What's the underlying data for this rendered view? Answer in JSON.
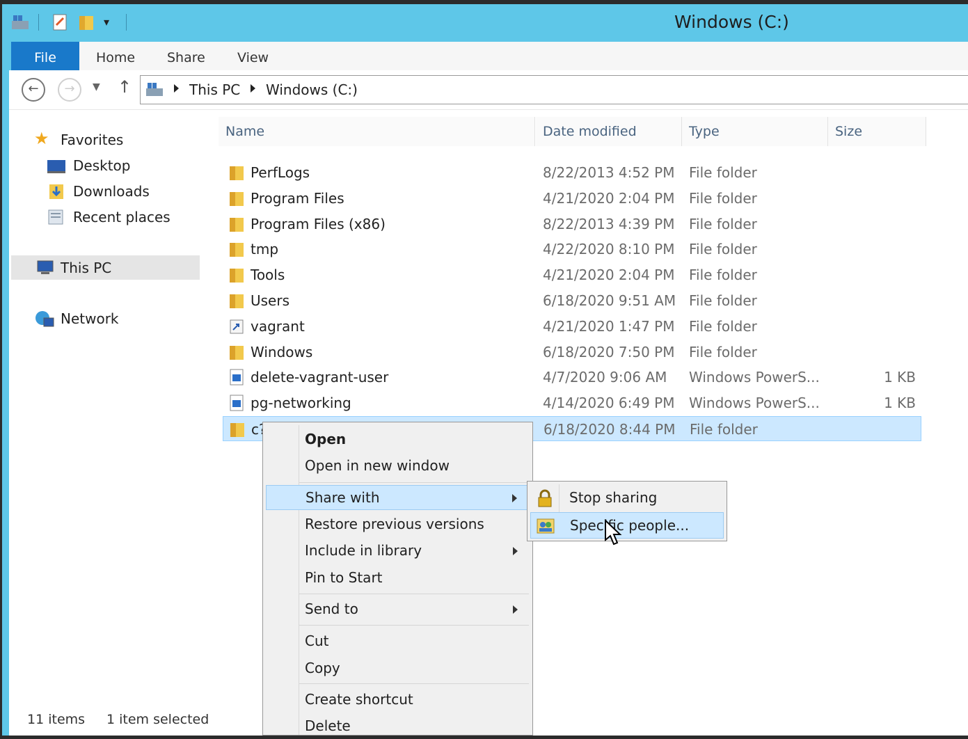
{
  "window": {
    "title": "Windows (C:)"
  },
  "ribbon": {
    "tabs": [
      "File",
      "Home",
      "Share",
      "View"
    ]
  },
  "address": {
    "crumbs": [
      "This PC",
      "Windows (C:)"
    ]
  },
  "sidebar": {
    "favorites": "Favorites",
    "items": [
      "Desktop",
      "Downloads",
      "Recent places"
    ],
    "this_pc": "This PC",
    "network": "Network"
  },
  "columns": {
    "name": "Name",
    "date": "Date modified",
    "type": "Type",
    "size": "Size"
  },
  "files": [
    {
      "name": "PerfLogs",
      "date": "8/22/2013 4:52 PM",
      "type": "File folder",
      "size": "",
      "icon": "folder-icon"
    },
    {
      "name": "Program Files",
      "date": "4/21/2020 2:04 PM",
      "type": "File folder",
      "size": "",
      "icon": "folder-icon"
    },
    {
      "name": "Program Files (x86)",
      "date": "8/22/2013 4:39 PM",
      "type": "File folder",
      "size": "",
      "icon": "folder-icon"
    },
    {
      "name": "tmp",
      "date": "4/22/2020 8:10 PM",
      "type": "File folder",
      "size": "",
      "icon": "folder-icon"
    },
    {
      "name": "Tools",
      "date": "4/21/2020 2:04 PM",
      "type": "File folder",
      "size": "",
      "icon": "folder-icon"
    },
    {
      "name": "Users",
      "date": "6/18/2020 9:51 AM",
      "type": "File folder",
      "size": "",
      "icon": "folder-icon"
    },
    {
      "name": "vagrant",
      "date": "4/21/2020 1:47 PM",
      "type": "File folder",
      "size": "",
      "icon": "shortcut-folder-icon"
    },
    {
      "name": "Windows",
      "date": "6/18/2020 7:50 PM",
      "type": "File folder",
      "size": "",
      "icon": "folder-icon"
    },
    {
      "name": "delete-vagrant-user",
      "date": "4/7/2020 9:06 AM",
      "type": "Windows PowerS...",
      "size": "1 KB",
      "icon": "powershell-file-icon"
    },
    {
      "name": "pg-networking",
      "date": "4/14/2020 6:49 PM",
      "type": "Windows PowerS...",
      "size": "1 KB",
      "icon": "powershell-file-icon"
    },
    {
      "name": "c?",
      "date": "6/18/2020 8:44 PM",
      "type": "File folder",
      "size": "",
      "icon": "folder-icon",
      "selected": true
    }
  ],
  "status": {
    "count": "11 items",
    "selection": "1 item selected"
  },
  "context_menu": {
    "items": [
      "Open",
      "Open in new window",
      "Share with",
      "Restore previous versions",
      "Include in library",
      "Pin to Start",
      "Send to",
      "Cut",
      "Copy",
      "Create shortcut",
      "Delete"
    ]
  },
  "share_submenu": {
    "items": [
      "Stop sharing",
      "Specific people..."
    ]
  },
  "colors": {
    "titlebar": "#5ec7e8",
    "file_tab": "#1979ca",
    "selection": "#cce8ff"
  }
}
